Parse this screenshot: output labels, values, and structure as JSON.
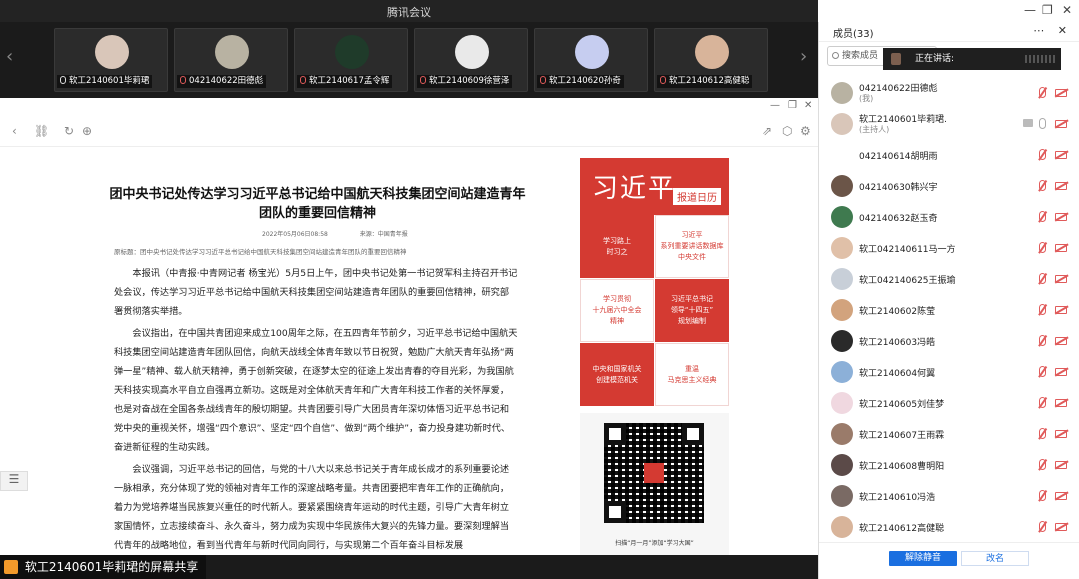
{
  "window": {
    "title": "腾讯会议",
    "controls": [
      "—",
      "❐",
      "✕"
    ]
  },
  "video_strip": {
    "tiles": [
      {
        "name": "软工2140601毕莉珺",
        "color": "#d9c6b9",
        "mic_on": true
      },
      {
        "name": "042140622田德彪",
        "color": "#b8b2a2",
        "mic_on": false
      },
      {
        "name": "软工2140617孟令辉",
        "color": "#1f3b2a",
        "mic_on": false
      },
      {
        "name": "软工2140609徐营泽",
        "color": "#e9e9e9",
        "mic_on": false
      },
      {
        "name": "软工2140620孙奇",
        "color": "#c6cdf0",
        "mic_on": false
      },
      {
        "name": "软工2140612高健聪",
        "color": "#d8b49a",
        "mic_on": false
      }
    ]
  },
  "article": {
    "title": "团中央书记处传达学习习近平总书记给中国航天科技集团空间站建造青年团队的重要回信精神",
    "date": "2022年05月06日08:58",
    "source": "来源：中国青年报",
    "subtitle": "原标题：团中央书记处传达学习习近平总书记给中国航天科技集团空间站建造青年团队的重要回信精神",
    "paragraphs": [
      "本报讯（中青报·中青网记者 杨宝光）5月5日上午，团中央书记处第一书记贺军科主持召开书记处会议，传达学习习近平总书记给中国航天科技集团空间站建造青年团队的重要回信精神，研究部署贯彻落实举措。",
      "会议指出，在中国共青团迎来成立100周年之际，在五四青年节前夕，习近平总书记给中国航天科技集团空间站建造青年团队回信，向航天战线全体青年致以节日祝贺，勉励广大航天青年弘扬“两弹一星”精神、载人航天精神，勇于创新突破，在逐梦太空的征途上发出青春的夺目光彩，为我国航天科技实现高水平自立自强再立新功。这既是对全体航天青年和广大青年科技工作者的关怀厚爱，也是对奋战在全国各条战线青年的殷切期望。共青团要引导广大团员青年深切体悟习近平总书记和党中央的重视关怀，增强“四个意识”、坚定“四个自信”、做到“两个维护”，奋力投身建功新时代、奋进新征程的生动实践。",
      "会议强调，习近平总书记的回信，与党的十八大以来总书记关于青年成长成才的系列重要论述一脉相承，充分体现了党的领袖对青年工作的深邃战略考量。共青团要把牢青年工作的正确航向，着力为党培养堪当民族复兴重任的时代新人。要紧紧围绕青年运动的时代主题，引导广大青年树立家国情怀，立志接续奋斗、永久奋斗，努力成为实现中华民族伟大复兴的先锋力量。要深刻理解当代青年的战略地位，看到当代青年与新时代同向同行，与实现第二个百年奋斗目标发展"
    ]
  },
  "sidebar_ad": {
    "banner_big": "习近平",
    "banner_tag": "报道日历",
    "cells": [
      {
        "text": "学习路上\n时习之",
        "style": "red"
      },
      {
        "text": "习近平\n系列重要讲话数据库\n中央文件",
        "style": "white"
      },
      {
        "text": "学习贯彻\n十九届六中全会\n精神",
        "style": "white"
      },
      {
        "text": "习近平总书记\n领导“十四五”\n规划编制",
        "style": "red"
      },
      {
        "text": "中央和国家机关\n创建模范机关",
        "style": "red"
      },
      {
        "text": "重温\n马克思主义经典",
        "style": "white"
      }
    ],
    "qr_caption": "扫描“月一月”添加“学习大国”"
  },
  "share_footer": {
    "label": "软工2140601毕莉珺的屏幕共享"
  },
  "panel": {
    "title": "成员(33)",
    "ops": "⋯ ✕",
    "search_placeholder": "搜索成员",
    "speaking": "正在讲话:",
    "members": [
      {
        "name": "042140622田德彪",
        "role": "(我)",
        "color": "#b8b2a2",
        "mic": false,
        "screen": false
      },
      {
        "name": "软工2140601毕莉珺.",
        "role": "(主持人)",
        "color": "#d9c6b9",
        "mic": true,
        "screen": true
      },
      {
        "name": "042140614胡明雨",
        "role": "",
        "color": "#ffffff",
        "mic": false,
        "screen": false
      },
      {
        "name": "042140630韩兴宇",
        "role": "",
        "color": "#6b5548",
        "mic": false,
        "screen": false
      },
      {
        "name": "042140632赵玉奇",
        "role": "",
        "color": "#3f7a4f",
        "mic": false,
        "screen": false
      },
      {
        "name": "软工042140611马一方",
        "role": "",
        "color": "#e0c0a8",
        "mic": false,
        "screen": false
      },
      {
        "name": "软工042140625王振瑜",
        "role": "",
        "color": "#c8cfd8",
        "mic": false,
        "screen": false
      },
      {
        "name": "软工2140602陈莹",
        "role": "",
        "color": "#d2a37d",
        "mic": false,
        "screen": false
      },
      {
        "name": "软工2140603冯皓",
        "role": "",
        "color": "#2a2a2a",
        "mic": false,
        "screen": false
      },
      {
        "name": "软工2140604何翼",
        "role": "",
        "color": "#8cb0d8",
        "mic": false,
        "screen": false
      },
      {
        "name": "软工2140605刘佳梦",
        "role": "",
        "color": "#f0d8e0",
        "mic": false,
        "screen": false
      },
      {
        "name": "软工2140607王雨霖",
        "role": "",
        "color": "#9a7b6a",
        "mic": false,
        "screen": false
      },
      {
        "name": "软工2140608曹明阳",
        "role": "",
        "color": "#5b4a48",
        "mic": false,
        "screen": false
      },
      {
        "name": "软工2140610冯浩",
        "role": "",
        "color": "#7a6a64",
        "mic": false,
        "screen": false
      },
      {
        "name": "软工2140612高健聪",
        "role": "",
        "color": "#d8b49a",
        "mic": false,
        "screen": false
      }
    ],
    "btn_mute_all": "解除静音",
    "btn_rename": "改名"
  }
}
